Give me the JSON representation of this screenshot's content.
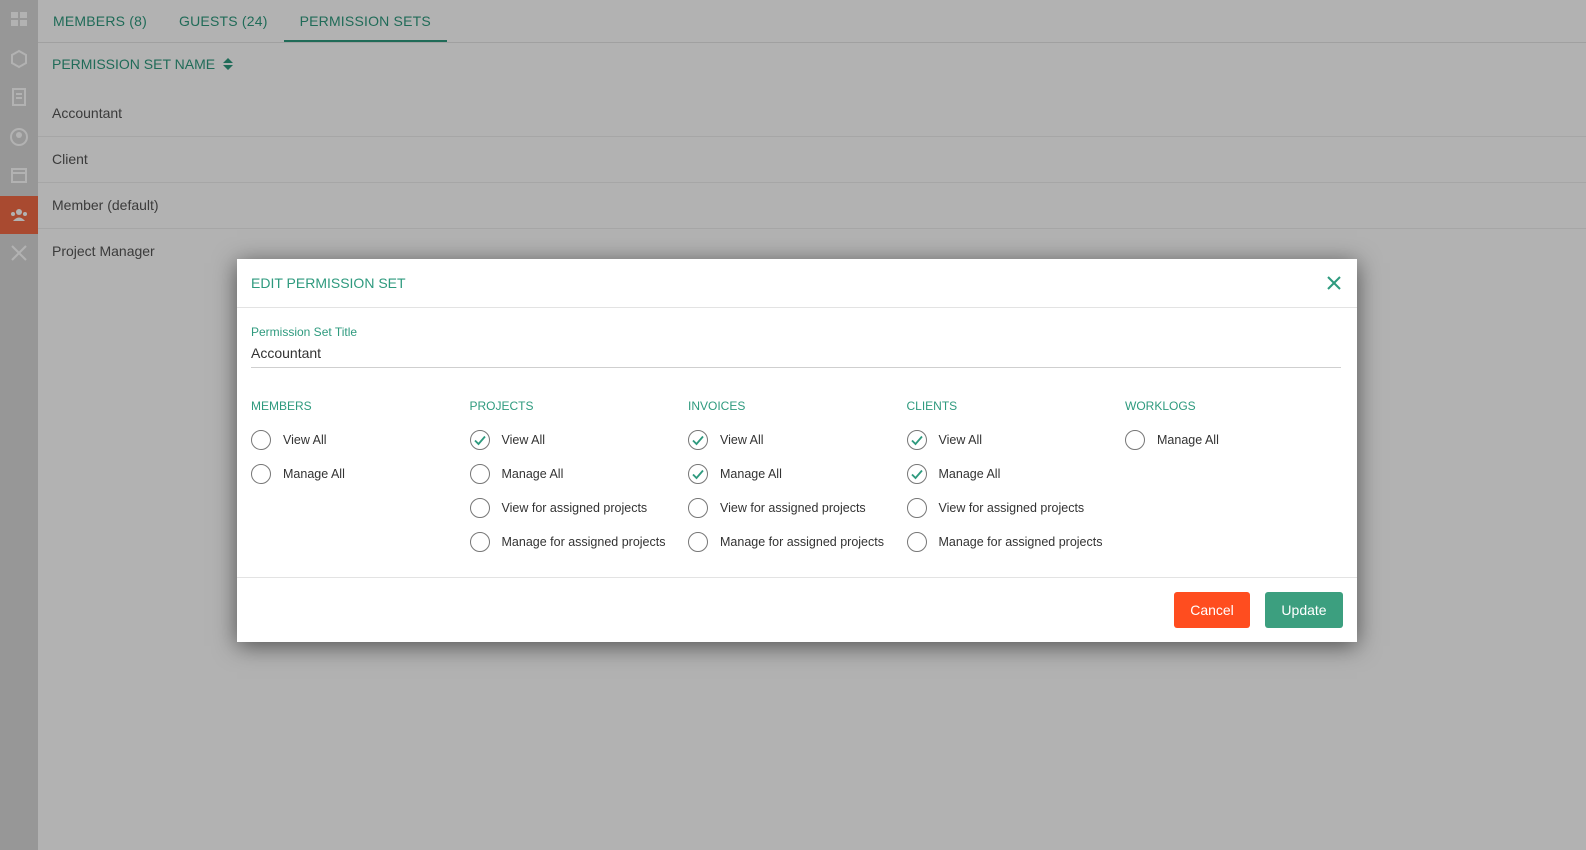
{
  "tabs": [
    {
      "label": "MEMBERS (8)",
      "active": false
    },
    {
      "label": "GUESTS (24)",
      "active": false
    },
    {
      "label": "PERMISSION SETS",
      "active": true
    }
  ],
  "list": {
    "header": "PERMISSION SET NAME",
    "rows": [
      "Accountant",
      "Client",
      "Member (default)",
      "Project Manager"
    ]
  },
  "sidebar": {
    "icons": [
      "dashboard-icon",
      "box-icon",
      "document-icon",
      "user-icon",
      "calendar-icon",
      "team-icon",
      "tools-icon"
    ],
    "active_icon": "team-icon"
  },
  "modal": {
    "title": "EDIT PERMISSION SET",
    "field_label": "Permission Set Title",
    "field_value": "Accountant",
    "groups": [
      {
        "title": "MEMBERS",
        "options": [
          {
            "label": "View All",
            "checked": false
          },
          {
            "label": "Manage All",
            "checked": false
          }
        ]
      },
      {
        "title": "PROJECTS",
        "options": [
          {
            "label": "View All",
            "checked": true
          },
          {
            "label": "Manage All",
            "checked": false
          },
          {
            "label": "View for assigned projects",
            "checked": false
          },
          {
            "label": "Manage for assigned projects",
            "checked": false
          }
        ]
      },
      {
        "title": "INVOICES",
        "options": [
          {
            "label": "View All",
            "checked": true
          },
          {
            "label": "Manage All",
            "checked": true
          },
          {
            "label": "View for assigned projects",
            "checked": false
          },
          {
            "label": "Manage for assigned projects",
            "checked": false
          }
        ]
      },
      {
        "title": "CLIENTS",
        "options": [
          {
            "label": "View All",
            "checked": true
          },
          {
            "label": "Manage All",
            "checked": true
          },
          {
            "label": "View for assigned projects",
            "checked": false
          },
          {
            "label": "Manage for assigned projects",
            "checked": false
          }
        ]
      },
      {
        "title": "WORKLOGS",
        "options": [
          {
            "label": "Manage All",
            "checked": false
          }
        ]
      }
    ],
    "cancel_label": "Cancel",
    "update_label": "Update"
  },
  "colors": {
    "accent": "#2e9a7e",
    "cancel": "#ff4d1f",
    "update": "#3c9f7f",
    "sidebar_active": "#f26b45"
  }
}
